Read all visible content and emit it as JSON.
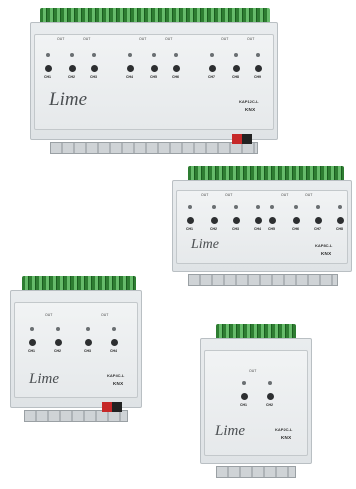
{
  "devices": [
    {
      "id": "dev1",
      "logo": "Lime",
      "model": "KAP12C-L",
      "bus": "KNX",
      "out_label": "OUT",
      "channels": [
        "CH1",
        "CH2",
        "CH3",
        "CH4",
        "CH5",
        "CH6",
        "CH7",
        "CH8",
        "CH9"
      ]
    },
    {
      "id": "dev2",
      "logo": "Lime",
      "model": "KAP8C-L",
      "bus": "KNX",
      "out_label": "OUT",
      "channels": [
        "CH1",
        "CH2",
        "CH3",
        "CH4",
        "CH5",
        "CH6",
        "CH7",
        "CH8"
      ]
    },
    {
      "id": "dev3",
      "logo": "Lime",
      "model": "KAP4C-L",
      "bus": "KNX",
      "out_label": "OUT",
      "channels": [
        "CH1",
        "CH2",
        "CH3",
        "CH4"
      ]
    },
    {
      "id": "dev4",
      "logo": "Lime",
      "model": "KAP2C-L",
      "bus": "KNX",
      "out_label": "OUT",
      "channels": [
        "CH1",
        "CH2"
      ]
    }
  ],
  "colors": {
    "terminal_green": "#2e7d32",
    "housing": "#e6e9eb",
    "button": "#2d2f31",
    "power_terminal": "#c62828"
  }
}
